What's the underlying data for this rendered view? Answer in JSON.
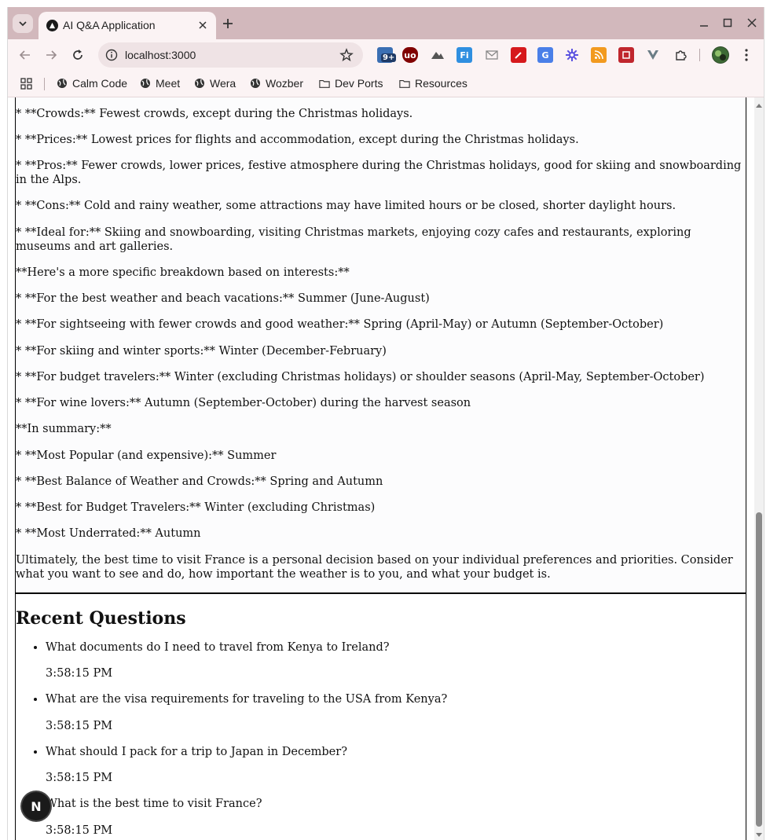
{
  "browser": {
    "tab_title": "AI Q&A Application",
    "url": "localhost:3000",
    "bookmarks": [
      {
        "label": "Calm Code",
        "icon": "globe-icon"
      },
      {
        "label": "Meet",
        "icon": "globe-icon"
      },
      {
        "label": "Wera",
        "icon": "globe-icon"
      },
      {
        "label": "Wozber",
        "icon": "globe-icon"
      },
      {
        "label": "Dev Ports",
        "icon": "folder-icon"
      },
      {
        "label": "Resources",
        "icon": "folder-icon"
      }
    ],
    "extension_badge": "9+"
  },
  "answer": {
    "lines": [
      "* **Crowds:** Fewest crowds, except during the Christmas holidays.",
      "* **Prices:** Lowest prices for flights and accommodation, except during the Christmas holidays.",
      "* **Pros:** Fewer crowds, lower prices, festive atmosphere during the Christmas holidays, good for skiing and snowboarding in the Alps.",
      "* **Cons:** Cold and rainy weather, some attractions may have limited hours or be closed, shorter daylight hours.",
      "* **Ideal for:** Skiing and snowboarding, visiting Christmas markets, enjoying cozy cafes and restaurants, exploring museums and art galleries.",
      "**Here's a more specific breakdown based on interests:**",
      "* **For the best weather and beach vacations:** Summer (June-August)",
      "* **For sightseeing with fewer crowds and good weather:** Spring (April-May) or Autumn (September-October)",
      "* **For skiing and winter sports:** Winter (December-February)",
      "* **For budget travelers:** Winter (excluding Christmas holidays) or shoulder seasons (April-May, September-October)",
      "* **For wine lovers:** Autumn (September-October) during the harvest season",
      "**In summary:**",
      "* **Most Popular (and expensive):** Summer",
      "* **Best Balance of Weather and Crowds:** Spring and Autumn",
      "* **Best for Budget Travelers:** Winter (excluding Christmas)",
      "* **Most Underrated:** Autumn"
    ],
    "conclusion": "Ultimately, the best time to visit France is a personal decision based on your individual preferences and priorities. Consider what you want to see and do, how important the weather is to you, and what your budget is."
  },
  "recent": {
    "title": "Recent Questions",
    "items": [
      {
        "question": "What documents do I need to travel from Kenya to Ireland?",
        "time": "3:58:15 PM"
      },
      {
        "question": "What are the visa requirements for traveling to the USA from Kenya?",
        "time": "3:58:15 PM"
      },
      {
        "question": "What should I pack for a trip to Japan in December?",
        "time": "3:58:15 PM"
      },
      {
        "question": "What is the best time to visit France?",
        "time": "3:58:15 PM"
      }
    ]
  },
  "nextjs_badge": "N"
}
